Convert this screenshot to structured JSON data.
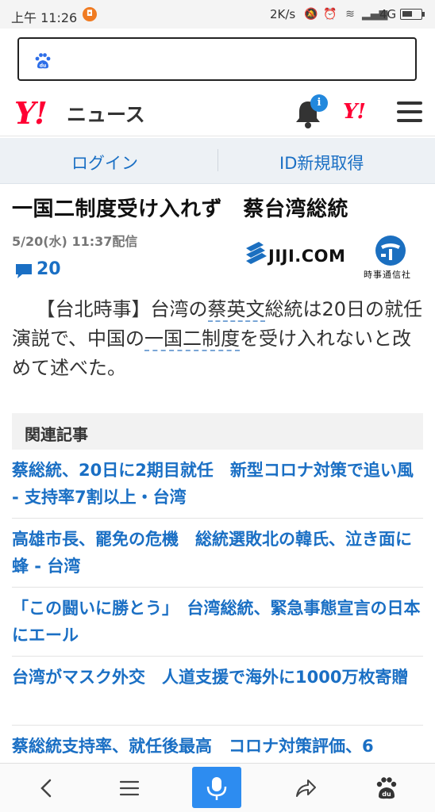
{
  "status_bar": {
    "time": "上午 11:26",
    "notification": "◘",
    "speed": "2K/s",
    "network": "4G",
    "battery_level": 0.55
  },
  "search": {
    "placeholder": ""
  },
  "header": {
    "logo_mark": "Y!",
    "logo_text": "ニュース",
    "notification_badge": "i",
    "yahoo_mark": "Y!"
  },
  "login_bar": {
    "login": "ログイン",
    "register": "ID新規取得"
  },
  "article": {
    "title": "一国二制度受け入れず　蔡台湾総統",
    "date": "5/20(水) 11:37配信",
    "comment_count": "20",
    "source_logo": "JIJI.COM",
    "source_name": "時事通信社",
    "body": {
      "p1": "【台北時事】台湾の",
      "kw1": "蔡英文",
      "p2": "総統は20日の就任演説で、中国の",
      "kw2": "一国二制度",
      "p3": "を受け入れないと改めて述べた。"
    }
  },
  "related": {
    "heading": "関連記事",
    "items": [
      "蔡総統、20日に2期目就任　新型コロナ対策で追い風 - 支持率7割以上・台湾",
      "高雄市長、罷免の危機　総統選敗北の韓氏、泣き面に蜂 - 台湾",
      "「この闘いに勝とう」　台湾総統、緊急事態宣言の日本にエール",
      "台湾がマスク外交　人道支援で海外に1000万枚寄贈",
      "蔡総統支持率、就任後最高　コロナ対策評価、6"
    ]
  },
  "colors": {
    "link": "#1a6fc4",
    "brand": "#ff0033",
    "mic": "#2d8cf0"
  }
}
